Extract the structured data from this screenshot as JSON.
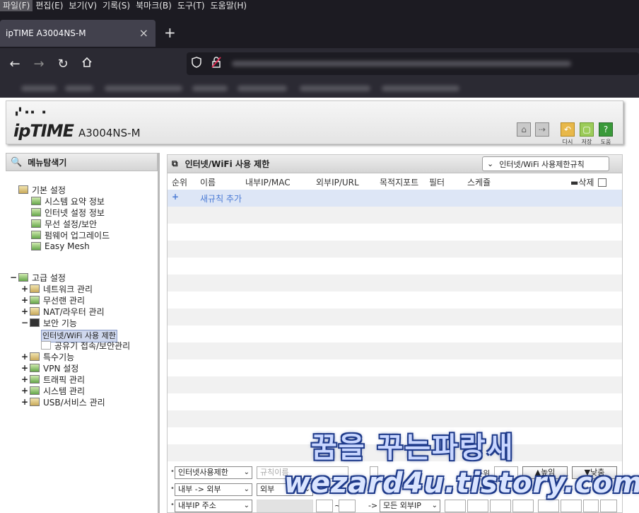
{
  "browser": {
    "menu": [
      "파일(F)",
      "편집(E)",
      "보기(V)",
      "기록(S)",
      "북마크(B)",
      "도구(T)",
      "도움말(H)"
    ],
    "tab_title": "ipTIME A3004NS-M",
    "tab_close": "×",
    "new_tab": "+"
  },
  "router": {
    "logo": "ipTIME",
    "model": "A3004NS-M",
    "header_buttons": [
      "다시",
      "저장",
      "도움"
    ],
    "sidebar_title": "메뉴탐색기",
    "tree": {
      "basic": "기본 설정",
      "basic_items": [
        "시스템 요약 정보",
        "인터넷 설정 정보",
        "무선 설정/보안",
        "펌웨어 업그레이드",
        "Easy Mesh"
      ],
      "advanced": "고급 설정",
      "advanced_items": [
        "네트워크 관리",
        "무선랜 관리",
        "NAT/라우터 관리",
        "보안 기능"
      ],
      "security_items": [
        "인터넷/WiFi 사용 제한",
        "공유기 접속/보안관리"
      ],
      "advanced_items2": [
        "특수기능",
        "VPN 설정",
        "트래픽 관리",
        "시스템 관리",
        "USB/서비스 관리"
      ]
    },
    "panel": {
      "title": "인터넷/WiFi 사용 제한",
      "rule_select": "인터넷/WiFi 사용제한규칙",
      "columns": [
        "순위",
        "이름",
        "내부IP/MAC",
        "외부IP/URL",
        "목적지포트",
        "필터",
        "스케쥴",
        "삭제"
      ],
      "add_rule": "새규칙 추가",
      "add_plus": "+"
    },
    "form": {
      "row1": {
        "type": "인터넷사용제한",
        "name_placeholder": "규칙이름",
        "order_label": "순위",
        "up": "▲높임",
        "down": "▼낮춤"
      },
      "row2": {
        "direction": "내부 -> 외부",
        "ext": "외부"
      },
      "row3": {
        "int_ip": "내부IP 주소",
        "arrow": "->",
        "ext_ip": "모든 외부IP",
        "tilde": "~"
      }
    }
  },
  "watermark": {
    "line1": "꿈을 꾸는파랑새",
    "line2": "wezard4u.tistory.com"
  }
}
